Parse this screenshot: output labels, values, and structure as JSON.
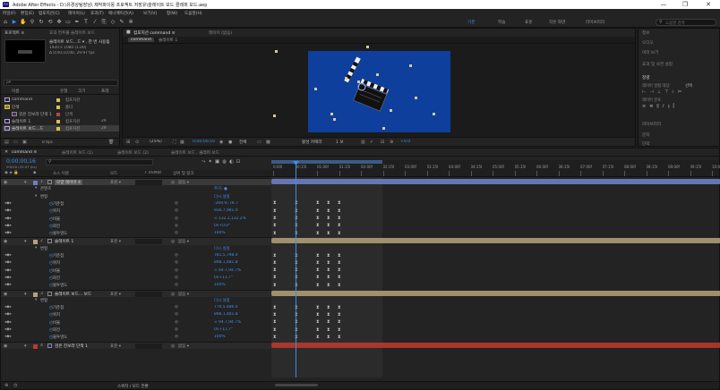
{
  "titlebar": {
    "title": "Adobe After Effects - D:\\유경상팀장님\\ 제작파이몽 프로젝트 저장유\\슬레이트 보드 클래퍼 보드.aep",
    "min": "—",
    "max": "❐",
    "close": "✕"
  },
  "menu": [
    "파일(F)",
    "편집(E)",
    "컴포지션(C)",
    "레이어(L)",
    "효과(T)",
    "애니메이션(A)",
    "보기(V)",
    "창(W)",
    "도움말(H)"
  ],
  "toolbar": {
    "tools": [
      "home-icon",
      "selection-icon",
      "hand-icon",
      "zoom-icon",
      "rotate-icon",
      "orbit-icon",
      "pan-behind-icon",
      "rectangle-icon",
      "pen-icon",
      "type-icon",
      "brush-icon",
      "clone-icon",
      "eraser-icon",
      "roto-icon",
      "puppet-icon"
    ],
    "workspaces": [
      "기본",
      "학습",
      "표준",
      "작은 화면",
      "라이브러리"
    ],
    "search_placeholder": "도움말 검색"
  },
  "project": {
    "tab_label": "프로젝트 ≡",
    "tab2_label": "효과 컨트롤 슬레이트 보드",
    "selected_name": "슬레이트 보드...드 ▾ , 한 번 사용됨",
    "selected_info1": "1920 x 1080 (1.00)",
    "selected_info2": "Δ 0;00;10;00, 29.97 fps",
    "search_placeholder": "ρ▾",
    "col_name": "이름",
    "col_type": "유형",
    "col_size": "크기",
    "col_fr": "프레",
    "rows": [
      {
        "name": "command",
        "type": "컴포지션",
        "size": "",
        "color": "#d8c34e"
      },
      {
        "name": "단색",
        "type": "폴더",
        "size": "",
        "color": "#d8c34e"
      },
      {
        "name": "검은 진보라 단색 1",
        "type": "단색",
        "size": "",
        "color": "#b04a4a"
      },
      {
        "name": "슬레이트 1",
        "type": "컴포지션",
        "size": "29",
        "color": "#d8c34e"
      },
      {
        "name": "슬레이트 보드...드",
        "type": "컴포지션",
        "size": "29",
        "color": "#d8c34e"
      }
    ],
    "bpc": "8 bpc"
  },
  "viewer": {
    "tab_label": "컴포지션 command ≡",
    "tab2_label": "레이어 (없음)",
    "breadcrumb1": "command",
    "breadcrumb2": "슬레이트 1",
    "zoom": "(25%)",
    "timecode": "0;00;00;16",
    "quality": "전체",
    "camera": "활성 카메라",
    "views": "1 보",
    "exposure": "+0.0"
  },
  "rightpanels": {
    "items": [
      "정보",
      "오디오",
      "미리 보기",
      "효과 및 사전 설정",
      "정렬",
      "라이브러리",
      "문자",
      "단락"
    ],
    "align_label": "레이어 정렬 대상:",
    "align_value": "선택",
    "distribute_label": "레이어 분포"
  },
  "timeline": {
    "tabs": [
      "command ≡",
      "슬레이트 보드 (1)",
      "슬레이트 보드 (2)",
      "슬레이트 보드 , 클래퍼 보드"
    ],
    "timecode": "0;00;00;16",
    "fps": "00016 (29.97 fps)",
    "col_src": "소스 이름",
    "col_mode": "모드",
    "col_trkmat": "T TrkMat",
    "col_parent": "상위 및 링크",
    "ruler": [
      "0:00f",
      "00:15f",
      "01:00f",
      "01:15f",
      "02:00f",
      "02:15f",
      "03:00f",
      "03:15f",
      "04:00f",
      "04:15f",
      "05:00f",
      "05:15f",
      "06:00f",
      "06:15f",
      "07:00f",
      "07:15f",
      "08:00f",
      "08:15f",
      "09:00f",
      "09:15f",
      "10:0"
    ],
    "rows": [
      {
        "kind": "layer",
        "num": "1",
        "name": "모양 레이어 4",
        "mode": "표준",
        "parent": "없음",
        "color": "#6b7ec4",
        "sel": true
      },
      {
        "kind": "sub",
        "name": "콘텐츠",
        "value": "추가: ●"
      },
      {
        "kind": "sub",
        "name": "변형",
        "value": "다시 설정"
      },
      {
        "kind": "prop",
        "name": "기준점",
        "value": "-269.9,-76.7"
      },
      {
        "kind": "prop",
        "name": "위치",
        "value": "936.7,981.0"
      },
      {
        "kind": "prop",
        "name": "비율",
        "value": "∞ 132.2,132.2%"
      },
      {
        "kind": "prop",
        "name": "회전",
        "value": "0x+0.0°"
      },
      {
        "kind": "prop",
        "name": "불투명도",
        "value": "100%"
      },
      {
        "kind": "layer",
        "num": "2",
        "name": "슬레이트 1",
        "mode": "표준",
        "parent": "없음",
        "color": "#b6a27a",
        "sel": false
      },
      {
        "kind": "sub",
        "name": "변형",
        "value": "다시 설정"
      },
      {
        "kind": "prop",
        "name": "기준점",
        "value": "781.5,798.0"
      },
      {
        "kind": "prop",
        "name": "위치",
        "value": "898.1,481.8"
      },
      {
        "kind": "prop",
        "name": "비율",
        "value": "∞ 94.7,94.7%"
      },
      {
        "kind": "prop",
        "name": "회전",
        "value": "0x+11.7°"
      },
      {
        "kind": "prop",
        "name": "불투명도",
        "value": "100%"
      },
      {
        "kind": "layer",
        "num": "3",
        "name": "슬레이트 보드... 보드",
        "mode": "표준",
        "parent": "없음",
        "color": "#b6a27a",
        "sel": false
      },
      {
        "kind": "sub",
        "name": "변형",
        "value": "다시 설정"
      },
      {
        "kind": "prop",
        "name": "기준점",
        "value": "776.5,486.0"
      },
      {
        "kind": "prop",
        "name": "위치",
        "value": "898.1,481.8"
      },
      {
        "kind": "prop",
        "name": "비율",
        "value": "∞ 94.7,94.7%"
      },
      {
        "kind": "prop",
        "name": "회전",
        "value": "0x+11.7°"
      },
      {
        "kind": "prop",
        "name": "불투명도",
        "value": "100%"
      },
      {
        "kind": "layer",
        "num": "4",
        "name": "검은 진보라 단색 1",
        "mode": "표준",
        "parent": "없음",
        "color": "#c0392b",
        "sel": false
      }
    ],
    "footer_toggle": "스위치 / 모드 전환"
  }
}
